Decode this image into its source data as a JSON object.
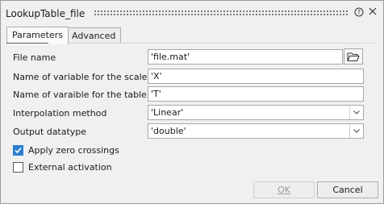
{
  "window": {
    "title": "LookupTable_file",
    "help_icon": "question-circle-icon",
    "close_icon": "close-icon"
  },
  "tabs": [
    {
      "label": "Parameters",
      "active": true
    },
    {
      "label": "Advanced",
      "active": false
    }
  ],
  "fields": {
    "file_name": {
      "label": "File name",
      "value": "'file.mat'",
      "browse_icon": "folder-open-icon"
    },
    "scale_var": {
      "label": "Name of variable for the scale",
      "value": "'X'"
    },
    "table_var": {
      "label": "Name of varaible for the table data",
      "value": "'T'"
    },
    "interp": {
      "label": "Interpolation method",
      "value": "'Linear'"
    },
    "datatype": {
      "label": "Output datatype",
      "value": "'double'"
    }
  },
  "checkboxes": {
    "zero_crossings": {
      "label": "Apply zero crossings",
      "checked": true
    },
    "external_activation": {
      "label": "External activation",
      "checked": false
    }
  },
  "buttons": {
    "ok": {
      "label": "OK",
      "enabled": false
    },
    "cancel": {
      "label": "Cancel",
      "enabled": true
    }
  },
  "colors": {
    "accent": "#2b7fd2",
    "background": "#f0f0f0"
  }
}
